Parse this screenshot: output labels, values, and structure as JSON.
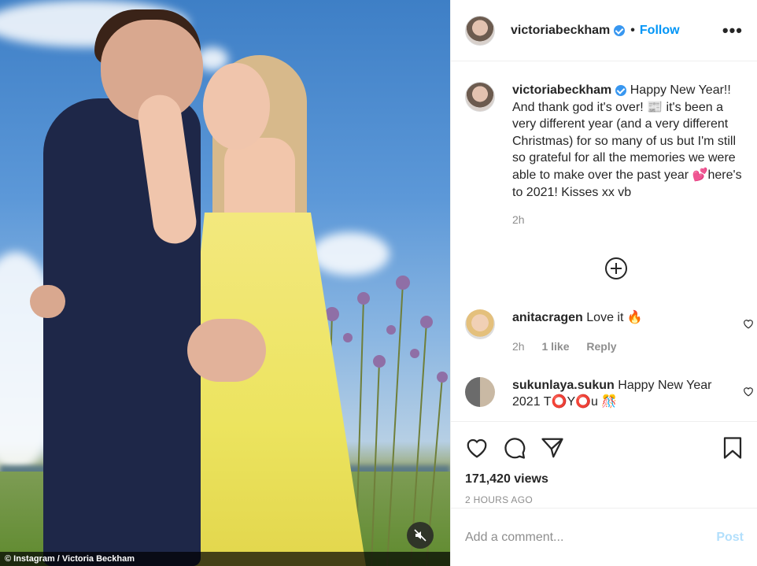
{
  "media": {
    "credit": "© Instagram / Victoria Beckham"
  },
  "header": {
    "username": "victoriabeckham",
    "separator": "•",
    "follow_label": "Follow",
    "more_label": "•••"
  },
  "caption": {
    "username": "victoriabeckham",
    "text": "Happy New Year!! And thank god it's over! 📰 it's been a very different year (and a very different Christmas) for so many of us but I'm still so grateful for all the memories we were able to make over the past year 💕here's to 2021! Kisses xx vb",
    "time": "2h"
  },
  "comments": [
    {
      "username": "anitacragen",
      "text": "Love it 🔥",
      "time": "2h",
      "likes": "1 like",
      "reply": "Reply"
    },
    {
      "username": "sukunlaya.sukun",
      "text": "Happy New Year 2021 T⭕Y⭕u 🎊"
    }
  ],
  "stats": {
    "views": "171,420 views",
    "posted": "2 HOURS AGO"
  },
  "comment_box": {
    "placeholder": "Add a comment...",
    "post_label": "Post"
  },
  "colors": {
    "follow": "#0095f6",
    "verified": "#3897f0",
    "post_disabled": "#b2dffc"
  }
}
